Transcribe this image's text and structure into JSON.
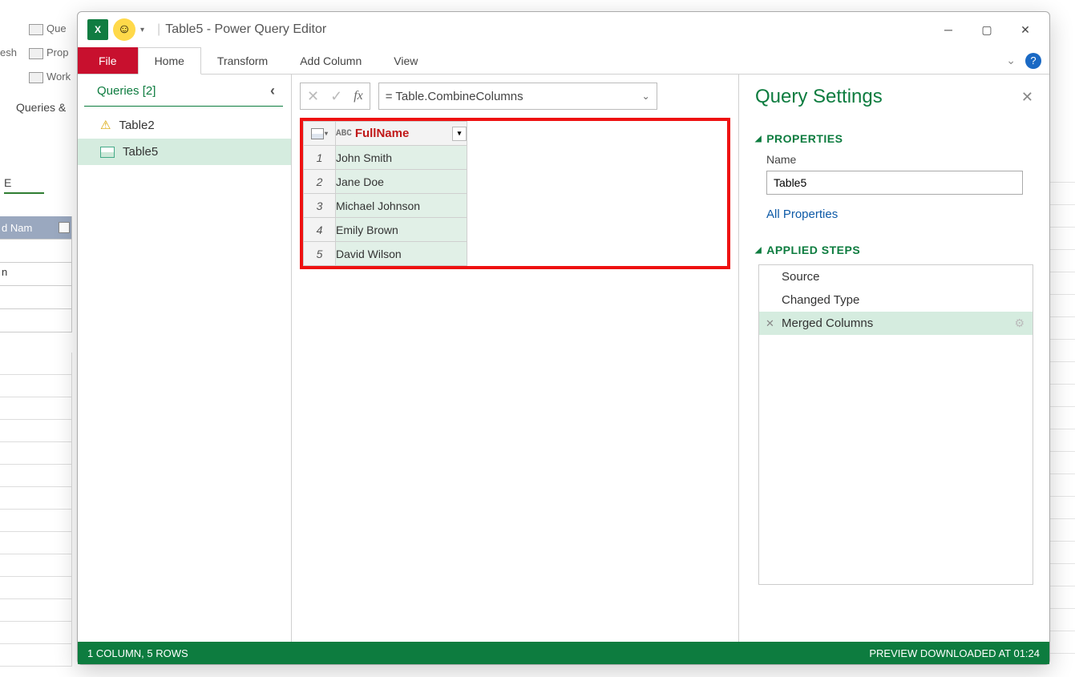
{
  "background": {
    "ribbon_items": [
      "Que",
      "Prop",
      "esh",
      "Work"
    ],
    "queries_label": "Queries &",
    "col_e": "E",
    "partial_header": "d Nam",
    "partial_cells": [
      "",
      "n",
      "",
      ""
    ]
  },
  "titlebar": {
    "title": "Table5 - Power Query Editor"
  },
  "tabs": {
    "file": "File",
    "home": "Home",
    "transform": "Transform",
    "add_column": "Add Column",
    "view": "View"
  },
  "queries_pane": {
    "header": "Queries [2]",
    "items": [
      {
        "name": "Table2",
        "warn": true
      },
      {
        "name": "Table5",
        "warn": false,
        "selected": true
      }
    ]
  },
  "formula": {
    "text": "= Table.CombineColumns"
  },
  "table": {
    "column_name": "FullName",
    "type_label": "ABC",
    "rows": [
      {
        "n": "1",
        "v": "John Smith"
      },
      {
        "n": "2",
        "v": "Jane Doe"
      },
      {
        "n": "3",
        "v": "Michael Johnson"
      },
      {
        "n": "4",
        "v": "Emily Brown"
      },
      {
        "n": "5",
        "v": "David Wilson"
      }
    ]
  },
  "settings": {
    "title": "Query Settings",
    "properties_label": "PROPERTIES",
    "name_label": "Name",
    "name_value": "Table5",
    "all_properties": "All Properties",
    "applied_steps_label": "APPLIED STEPS",
    "steps": [
      {
        "name": "Source",
        "selected": false,
        "gear": false,
        "del": false
      },
      {
        "name": "Changed Type",
        "selected": false,
        "gear": false,
        "del": false
      },
      {
        "name": "Merged Columns",
        "selected": true,
        "gear": true,
        "del": true
      }
    ]
  },
  "status": {
    "left": "1 COLUMN, 5 ROWS",
    "right": "PREVIEW DOWNLOADED AT 01:24"
  }
}
